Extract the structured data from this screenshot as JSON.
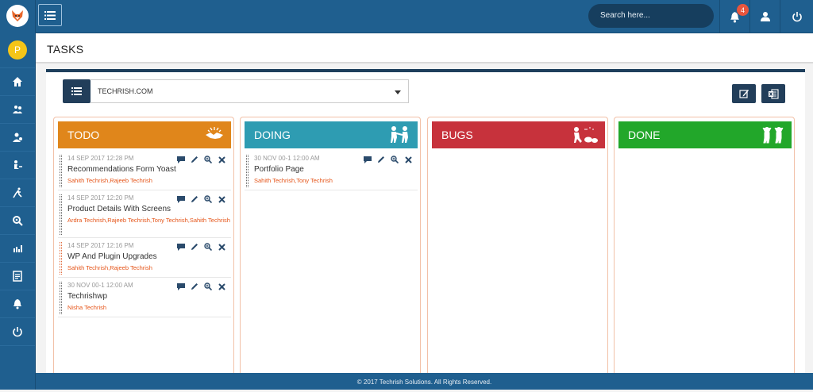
{
  "sidebar": {
    "avatar_letter": "P",
    "items": [
      "home",
      "users",
      "user-group",
      "transfer",
      "runner",
      "settings",
      "reports",
      "docs",
      "notifications",
      "logout"
    ]
  },
  "topbar": {
    "search_placeholder": "Search here...",
    "notification_count": "4"
  },
  "page": {
    "title": "TASKS"
  },
  "project": {
    "selected": "TECHRISH.COM"
  },
  "columns": [
    {
      "name": "TODO",
      "color": "#e0861b"
    },
    {
      "name": "DOING",
      "color": "#2e9cb2"
    },
    {
      "name": "BUGS",
      "color": "#c7323c"
    },
    {
      "name": "DONE",
      "color": "#22a72a"
    }
  ],
  "todo": [
    {
      "time": "14 SEP 2017 12:28 PM",
      "title": "Recommendations Form Yoast",
      "users": "Sahith Techrish,Rajeeb Techrish"
    },
    {
      "time": "14 SEP 2017 12:20 PM",
      "title": "Product Details With Screens",
      "users": "Ardra Techrish,Rajeeb Techrish,Tony Techrish,Sahith Techrish"
    },
    {
      "time": "14 SEP 2017 12:16 PM",
      "title": "WP And Plugin Upgrades",
      "users": "Sahith Techrish,Rajeeb Techrish"
    },
    {
      "time": "30 NOV 00-1 12:00 AM",
      "title": "Techrishwp",
      "users": "Nisha Techrish"
    }
  ],
  "doing": [
    {
      "time": "30 NOV 00-1 12:00 AM",
      "title": "Portfolio Page",
      "users": "Sahith Techrish,Tony Techrish"
    }
  ],
  "footer": {
    "text": "© 2017 Techrish Solutions. All Rights Reserved."
  }
}
